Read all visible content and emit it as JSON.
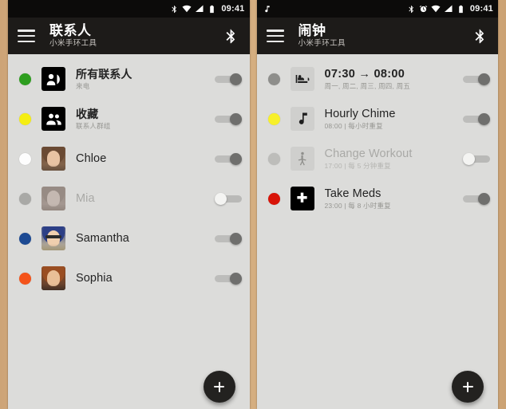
{
  "panels": [
    {
      "name": "contacts",
      "statusbar": {
        "time": "09:41",
        "icons": [
          "bluetooth-icon",
          "wifi-icon",
          "signal-icon",
          "battery-icon"
        ]
      },
      "appbar": {
        "menu_icon": "hamburger-menu-icon",
        "title": "联系人",
        "subtitle": "小米手环工具",
        "action_icon": "bluetooth-icon"
      },
      "fab": {
        "label": "+",
        "icon": "plus-icon"
      },
      "rows": [
        {
          "dot_color": "#2e9e1f",
          "icon": "contacts-group-icon",
          "title": "所有联系人",
          "subtitle": "来电",
          "toggle": "on",
          "enabled": true,
          "thumb_type": "icon-dark"
        },
        {
          "dot_color": "#f5ee12",
          "icon": "favorites-group-icon",
          "title": "收藏",
          "subtitle": "联系人群组",
          "toggle": "on",
          "enabled": true,
          "thumb_type": "icon-dark"
        },
        {
          "dot_color": "#fdfdfd",
          "icon": "contact-avatar",
          "title": "Chloe",
          "subtitle": "",
          "toggle": "on",
          "enabled": true,
          "thumb_type": "photo-chloe"
        },
        {
          "dot_color": "#a9a9a6",
          "icon": "contact-avatar",
          "title": "Mia",
          "subtitle": "",
          "toggle": "off",
          "enabled": false,
          "thumb_type": "photo-mia"
        },
        {
          "dot_color": "#1d4a93",
          "icon": "contact-avatar",
          "title": "Samantha",
          "subtitle": "",
          "toggle": "on",
          "enabled": true,
          "thumb_type": "photo-samantha"
        },
        {
          "dot_color": "#f4531a",
          "icon": "contact-avatar",
          "title": "Sophia",
          "subtitle": "",
          "toggle": "on",
          "enabled": true,
          "thumb_type": "photo-sophia"
        }
      ]
    },
    {
      "name": "alarms",
      "statusbar": {
        "time": "09:41",
        "icons": [
          "music-note-icon",
          "bluetooth-icon",
          "alarm-clock-icon",
          "wifi-icon",
          "signal-icon",
          "battery-icon"
        ]
      },
      "appbar": {
        "menu_icon": "hamburger-menu-icon",
        "title": "闹钟",
        "subtitle": "小米手环工具",
        "action_icon": "bluetooth-icon"
      },
      "fab": {
        "label": "+",
        "icon": "plus-icon"
      },
      "rows": [
        {
          "dot_color": "#8e8e8b",
          "icon": "bed-icon",
          "title": "07:30 → 08:00",
          "subtitle": "周一, 周二, 周三, 周四, 周五",
          "toggle": "on",
          "enabled": true,
          "thumb_type": "icon-soft"
        },
        {
          "dot_color": "#f7f02a",
          "icon": "music-note-icon",
          "title": "Hourly Chime",
          "subtitle": "08:00 | 每小时重复",
          "toggle": "on",
          "enabled": true,
          "thumb_type": "icon-soft"
        },
        {
          "dot_color": "#bdbdba",
          "icon": "workout-person-icon",
          "title": "Change Workout",
          "subtitle": "17:00 | 每 5 分钟重复",
          "toggle": "off",
          "enabled": false,
          "thumb_type": "icon-soft"
        },
        {
          "dot_color": "#d81408",
          "icon": "medical-cross-icon",
          "title": "Take Meds",
          "subtitle": "23:00 | 每 8 小时重复",
          "toggle": "on",
          "enabled": true,
          "thumb_type": "icon-dark"
        }
      ]
    }
  ],
  "colors": {
    "appbar": "#1d1b19",
    "statusbar": "#0c0b0a",
    "content": "#dcdcda",
    "frame": "#d5ab7d",
    "fab": "#232220"
  }
}
